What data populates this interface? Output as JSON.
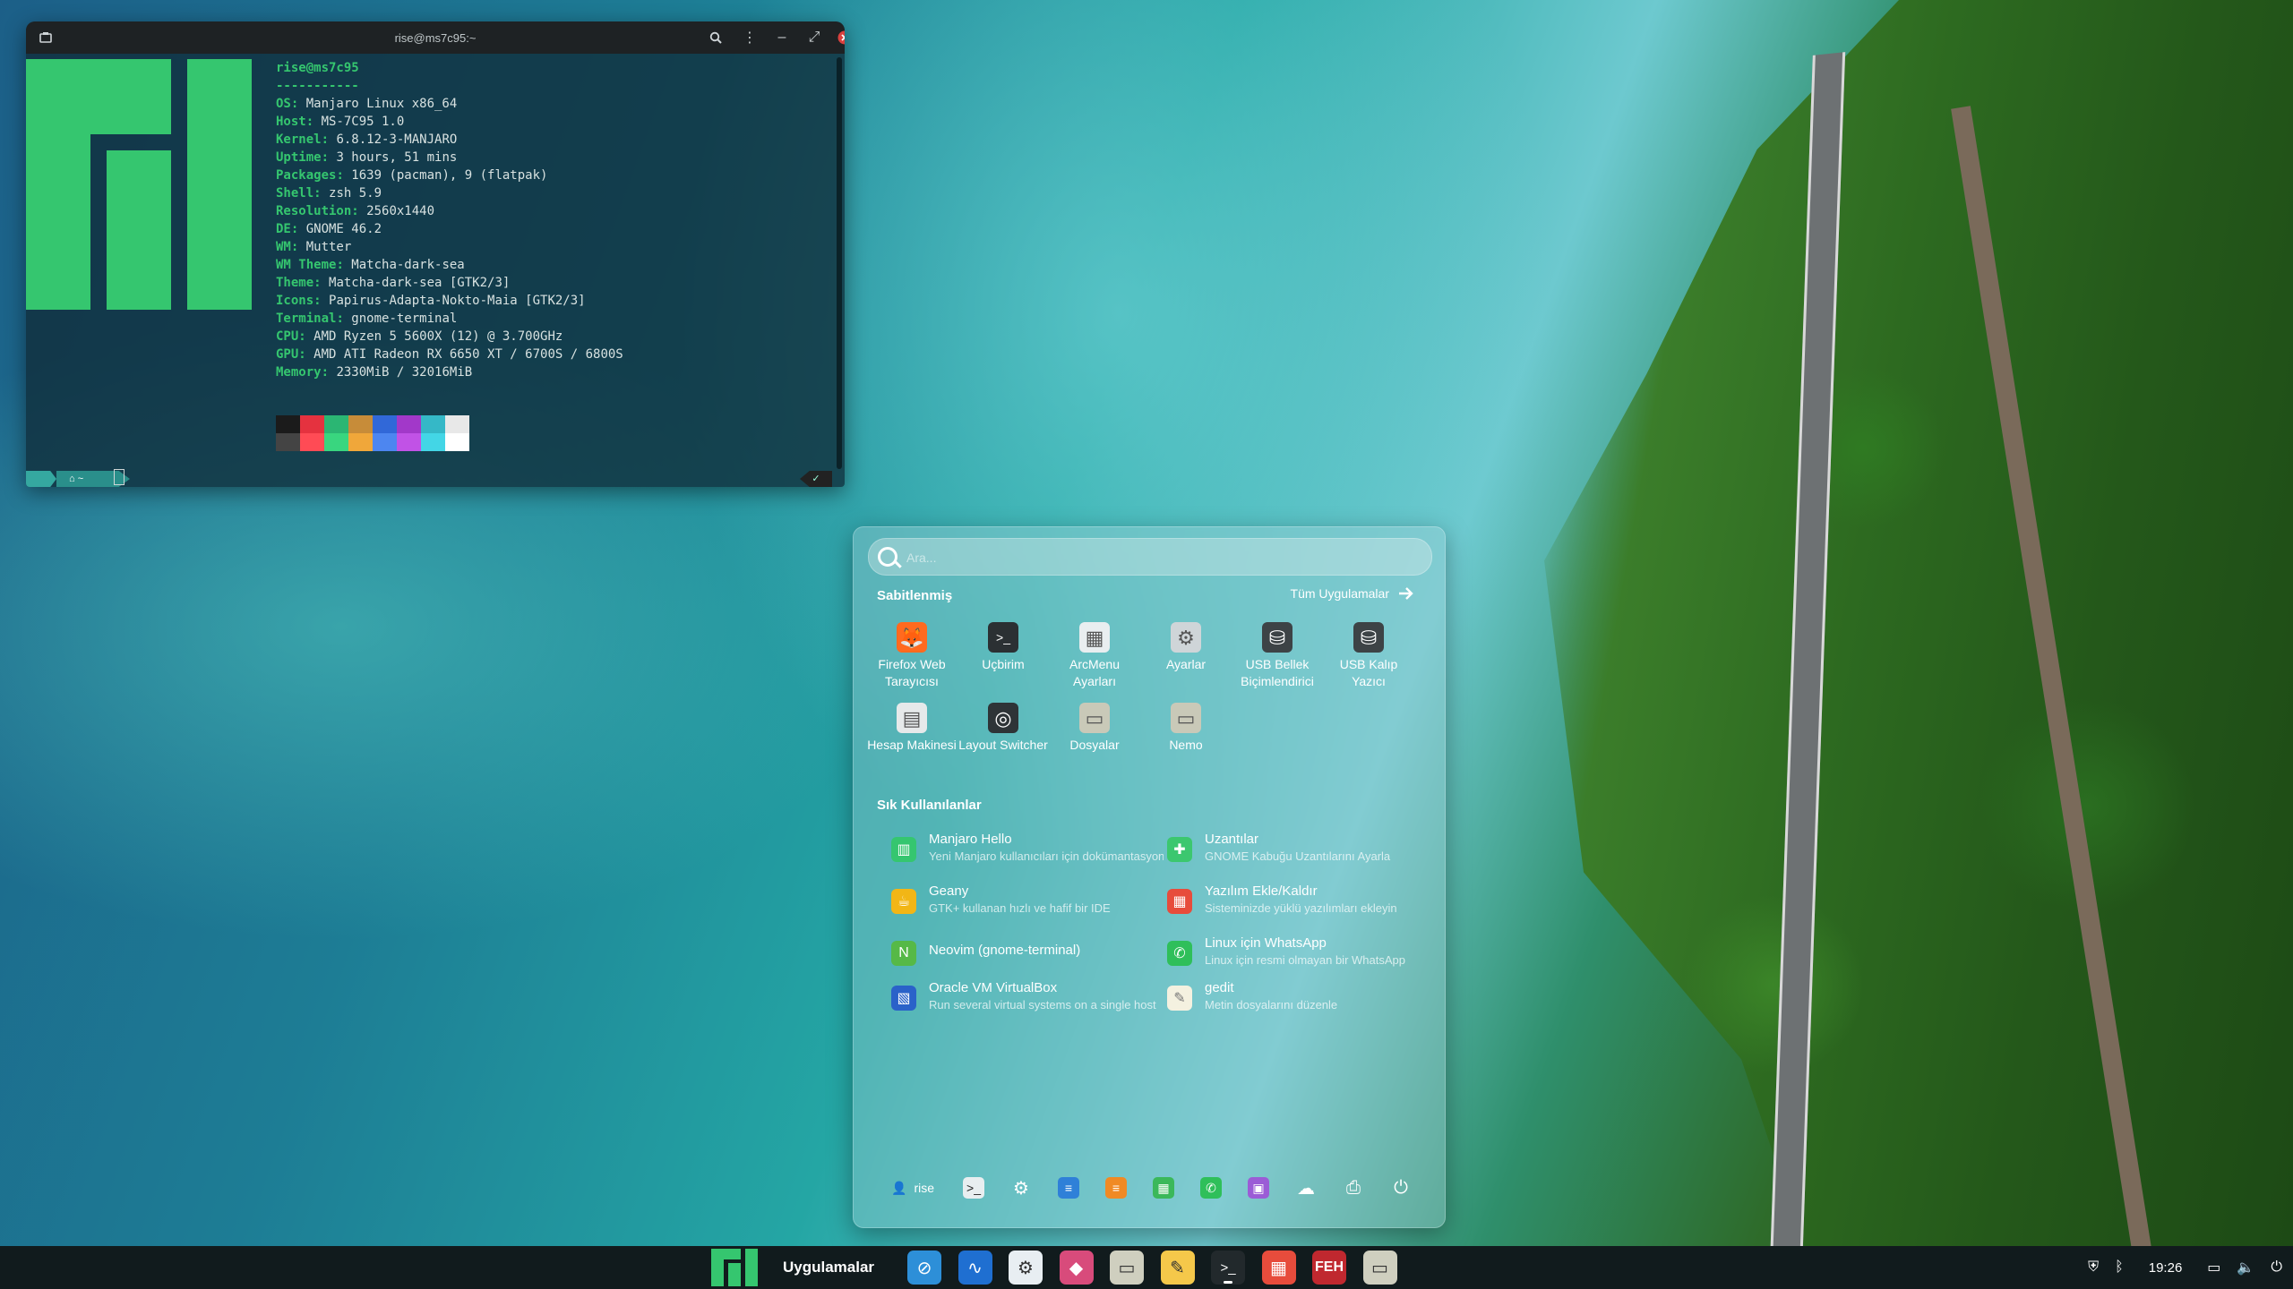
{
  "terminal": {
    "title": "rise@ms7c95:~",
    "user_host": "rise@ms7c95",
    "separator": "-----------",
    "info": [
      {
        "key": "OS",
        "value": "Manjaro Linux x86_64"
      },
      {
        "key": "Host",
        "value": "MS-7C95 1.0"
      },
      {
        "key": "Kernel",
        "value": "6.8.12-3-MANJARO"
      },
      {
        "key": "Uptime",
        "value": "3 hours, 51 mins"
      },
      {
        "key": "Packages",
        "value": "1639 (pacman), 9 (flatpak)"
      },
      {
        "key": "Shell",
        "value": "zsh 5.9"
      },
      {
        "key": "Resolution",
        "value": "2560x1440"
      },
      {
        "key": "DE",
        "value": "GNOME 46.2"
      },
      {
        "key": "WM",
        "value": "Mutter"
      },
      {
        "key": "WM Theme",
        "value": "Matcha-dark-sea"
      },
      {
        "key": "Theme",
        "value": "Matcha-dark-sea [GTK2/3]"
      },
      {
        "key": "Icons",
        "value": "Papirus-Adapta-Nokto-Maia [GTK2/3]"
      },
      {
        "key": "Terminal",
        "value": "gnome-terminal"
      },
      {
        "key": "CPU",
        "value": "AMD Ryzen 5 5600X (12) @ 3.700GHz"
      },
      {
        "key": "GPU",
        "value": "AMD ATI Radeon RX 6650 XT / 6700S / 6800S"
      },
      {
        "key": "Memory",
        "value": "2330MiB / 32016MiB"
      }
    ],
    "palette_top": [
      "#1b1b1b",
      "#e5323f",
      "#2bb673",
      "#c78c39",
      "#3168d8",
      "#a238c9",
      "#35b8c7",
      "#e8e8e8"
    ],
    "palette_bottom": [
      "#444444",
      "#ff4b55",
      "#39d67f",
      "#f0a73a",
      "#4d86f0",
      "#c152e6",
      "#43d6e6",
      "#ffffff"
    ],
    "prompt_dir": "~",
    "prompt_status": "✓"
  },
  "arcmenu": {
    "search_placeholder": "Ara...",
    "pinned_title": "Sabitlenmiş",
    "all_apps_label": "Tüm Uygulamalar",
    "pinned": [
      {
        "label": "Firefox Web Tarayıcısı",
        "icon": "firefox-icon",
        "color": "#ff6a1f"
      },
      {
        "label": "Uçbirim",
        "icon": "terminal-icon",
        "color": "#2b3033"
      },
      {
        "label": "ArcMenu Ayarları",
        "icon": "arcmenu-icon",
        "color": "#e9eef0"
      },
      {
        "label": "Ayarlar",
        "icon": "gear-icon",
        "color": "#cfd5d8"
      },
      {
        "label": "USB Bellek Biçimlendirici",
        "icon": "usb-format-icon",
        "color": "#3d4346"
      },
      {
        "label": "USB Kalıp Yazıcı",
        "icon": "usb-writer-icon",
        "color": "#3d4346"
      },
      {
        "label": "Hesap Makinesi",
        "icon": "calculator-icon",
        "color": "#e6e9ea"
      },
      {
        "label": "Layout Switcher",
        "icon": "layout-switcher-icon",
        "color": "#2e3437"
      },
      {
        "label": "Dosyalar",
        "icon": "folder-icon",
        "color": "#c9c9b8"
      },
      {
        "label": "Nemo",
        "icon": "nemo-folder-icon",
        "color": "#c9c9b8"
      }
    ],
    "frequent_title": "Sık Kullanılanlar",
    "frequent": [
      {
        "name": "Manjaro Hello",
        "desc": "Yeni Manjaro kullanıcıları için dokümantasyon",
        "icon": "manjaro-icon",
        "color": "#35c66f"
      },
      {
        "name": "Uzantılar",
        "desc": "GNOME Kabuğu Uzantılarını Ayarla",
        "icon": "puzzle-icon",
        "color": "#3cc76f"
      },
      {
        "name": "Geany",
        "desc": "GTK+ kullanan hızlı ve hafif bir IDE",
        "icon": "geany-icon",
        "color": "#f2b616"
      },
      {
        "name": "Yazılım Ekle/Kaldır",
        "desc": "Sisteminizde yüklü yazılımları ekleyin",
        "icon": "software-icon",
        "color": "#e74c3c"
      },
      {
        "name": "Neovim (gnome-terminal)",
        "desc": "",
        "icon": "neovim-icon",
        "color": "#56b947"
      },
      {
        "name": "Linux için WhatsApp",
        "desc": "Linux için resmi olmayan bir WhatsApp",
        "icon": "whatsapp-icon",
        "color": "#2fbf5a"
      },
      {
        "name": "Oracle VM VirtualBox",
        "desc": "Run several virtual systems on a single host",
        "icon": "virtualbox-icon",
        "color": "#2a62c9"
      },
      {
        "name": "gedit",
        "desc": "Metin dosyalarını düzenle",
        "icon": "gedit-icon",
        "color": "#f4f1e0"
      }
    ],
    "footer_user": "rise",
    "footer_icons": [
      {
        "icon": "terminal-icon",
        "color": "#e8eef0",
        "glyph": ">_"
      },
      {
        "icon": "gear-icon",
        "color": "transparent",
        "glyph": "⚙"
      },
      {
        "icon": "document-icon",
        "color": "#2f80d8",
        "glyph": "≡"
      },
      {
        "icon": "orange-doc-icon",
        "color": "#f08a24",
        "glyph": "≡"
      },
      {
        "icon": "spreadsheet-icon",
        "color": "#3bb85a",
        "glyph": "▦"
      },
      {
        "icon": "whatsapp-icon",
        "color": "#2fbf5a",
        "glyph": "✆"
      },
      {
        "icon": "monitor-icon",
        "color": "#9b5cd6",
        "glyph": "▣"
      },
      {
        "icon": "cloud-icon",
        "color": "transparent",
        "glyph": "☁"
      },
      {
        "icon": "printer-icon",
        "color": "transparent",
        "glyph": "⎙"
      },
      {
        "icon": "power-icon",
        "color": "transparent",
        "glyph": "⏻"
      }
    ]
  },
  "taskbar": {
    "apps_label": "Uygulamalar",
    "apps": [
      {
        "icon": "safari-compass-icon",
        "color": "#2d8fd8",
        "glyph": "⊘"
      },
      {
        "icon": "waveform-monitor-icon",
        "color": "#1f6fd1",
        "glyph": "∿"
      },
      {
        "icon": "settings-toggle-icon",
        "color": "#e8eef2",
        "glyph": "⚙"
      },
      {
        "icon": "color-cube-icon",
        "color": "#d84b7b",
        "glyph": "◆"
      },
      {
        "icon": "files-folder-icon",
        "color": "#cfcfbf",
        "glyph": "▭"
      },
      {
        "icon": "text-editor-icon",
        "color": "#f5c84a",
        "glyph": "✎"
      },
      {
        "icon": "terminal-icon",
        "color": "#22292c",
        "glyph": ">_"
      },
      {
        "icon": "software-store-icon",
        "color": "#e74c3c",
        "glyph": "▦"
      },
      {
        "icon": "feh-icon",
        "color": "#c0282f",
        "glyph": "FEH"
      },
      {
        "icon": "archive-folder-icon",
        "color": "#cfcfbf",
        "glyph": "▭"
      }
    ],
    "clock": "19:26"
  }
}
